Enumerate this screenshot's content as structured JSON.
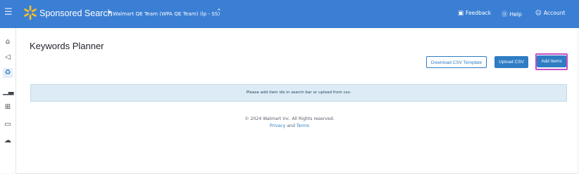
{
  "header": {
    "menu_icon": "hamburger-icon",
    "brand": "Sponsored Search",
    "brand_caret": "▾",
    "team": "Walmart QE Team (WPA QE Team) (lp - SS)",
    "team_caret": "⌃",
    "feedback_label": "Feedback",
    "help_label": "Help",
    "account_label": "Account",
    "brand_color": "#3b7fd4"
  },
  "sidebar": {
    "items": [
      {
        "icon": "home-icon"
      },
      {
        "icon": "megaphone-icon"
      },
      {
        "icon": "recycle-icon"
      },
      {
        "icon": "bar-chart-icon"
      },
      {
        "icon": "calendar-plus-icon"
      },
      {
        "icon": "video-icon"
      },
      {
        "icon": "cloud-upload-icon"
      }
    ]
  },
  "main": {
    "title": "Keywords Planner",
    "download_csv_label": "Download CSV Template",
    "upload_csv_label": "Upload CSV",
    "add_items_label": "Add Items",
    "notice_text": "Please add item ids in search bar or upload from csv."
  },
  "footer": {
    "copyright": "© 2024 Walmart Inc. All Rights reserved.",
    "privacy_label": "Privacy",
    "and_text": "and",
    "terms_label": "Terms"
  },
  "colors": {
    "accent": "#2e7cc4",
    "highlight_outline": "#c24ec4",
    "notice_bg": "#dcebf5"
  }
}
